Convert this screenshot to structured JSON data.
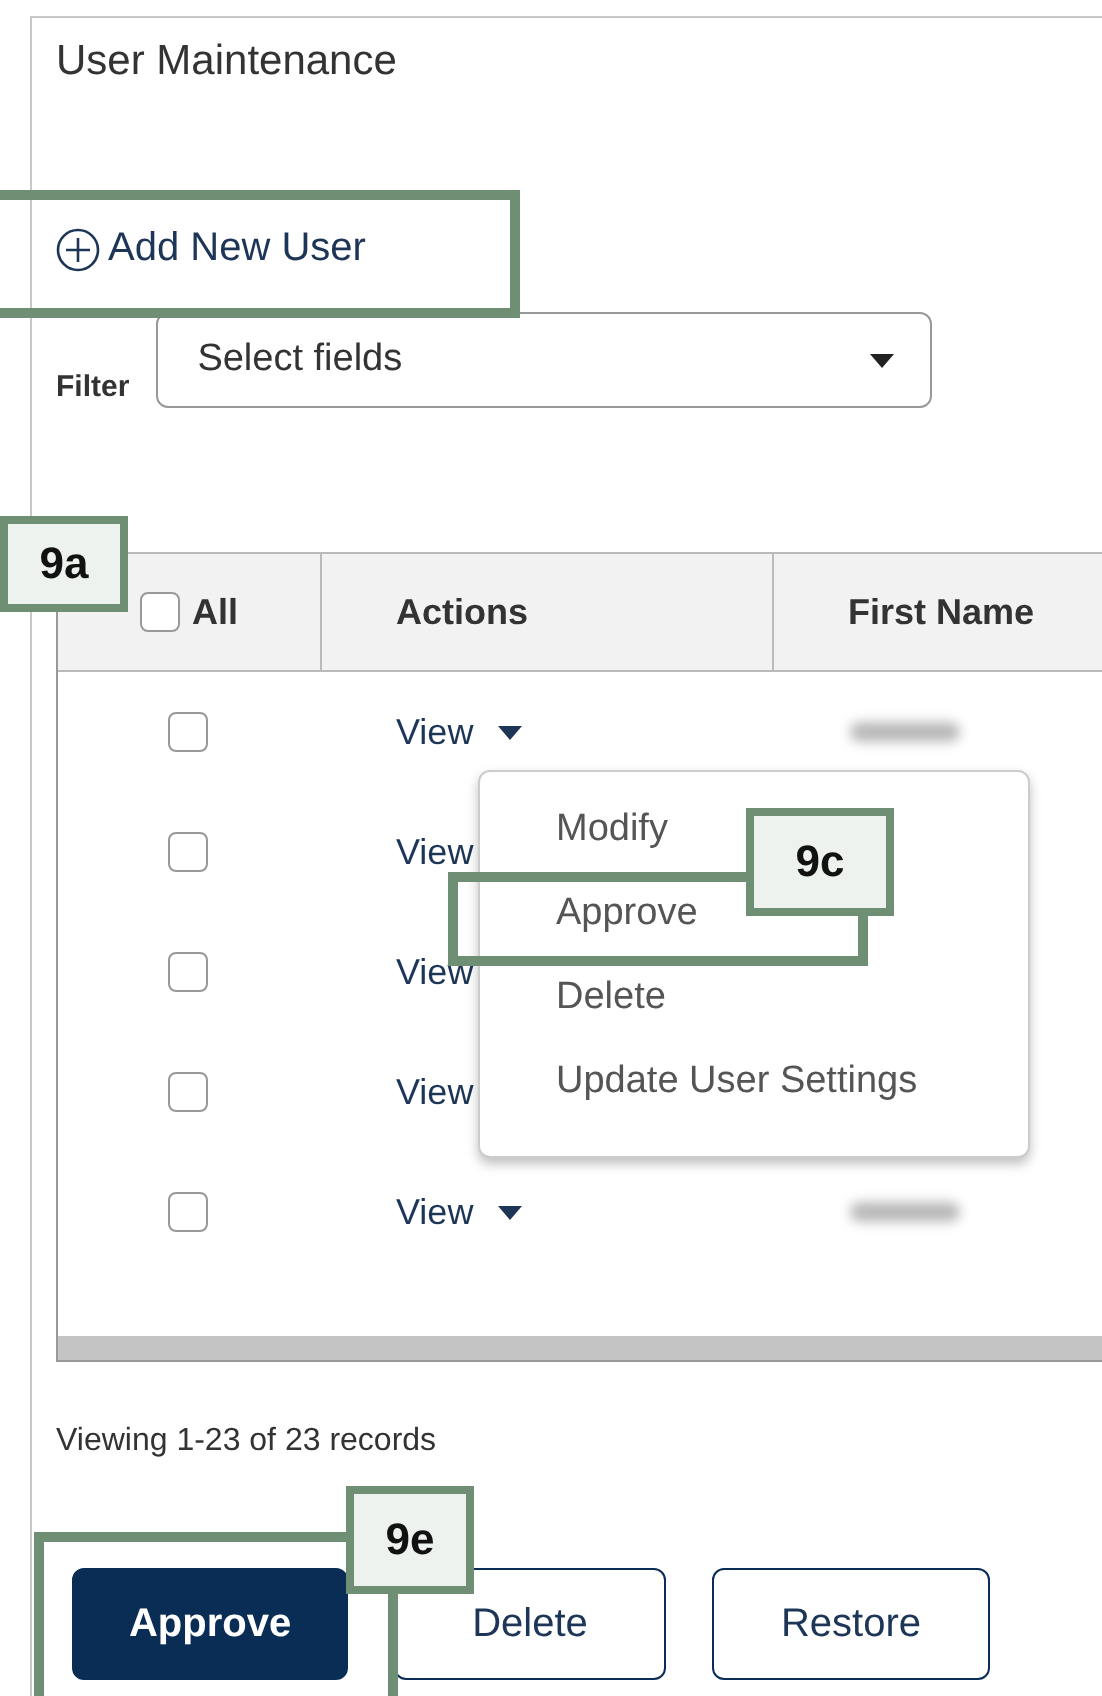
{
  "panel": {
    "title": "User Maintenance"
  },
  "add_link": {
    "label": "Add New User"
  },
  "filter": {
    "label": "Filter",
    "placeholder": "Select fields"
  },
  "table": {
    "select_all": {
      "label": "All",
      "checked": false
    },
    "columns": [
      "Actions",
      "First Name"
    ],
    "rows": [
      {
        "checked": false,
        "action": "View",
        "has_menu_caret": true,
        "name_blurred": true
      },
      {
        "checked": false,
        "action": "View",
        "has_menu_caret": false
      },
      {
        "checked": false,
        "action": "View",
        "has_menu_caret": false
      },
      {
        "checked": false,
        "action": "View",
        "has_menu_caret": false
      },
      {
        "checked": false,
        "action": "View",
        "has_menu_caret": true,
        "name_blurred": true
      }
    ]
  },
  "action_menu": {
    "items": [
      "Modify",
      "Approve",
      "Delete",
      "Update User Settings"
    ]
  },
  "status": "Viewing 1-23 of 23 records",
  "buttons": [
    {
      "label": "Approve",
      "primary": true
    },
    {
      "label": "Delete",
      "primary": false
    },
    {
      "label": "Restore",
      "primary": false
    }
  ],
  "callouts": [
    {
      "label": "9a"
    },
    {
      "label": "9c"
    },
    {
      "label": "9e"
    }
  ]
}
